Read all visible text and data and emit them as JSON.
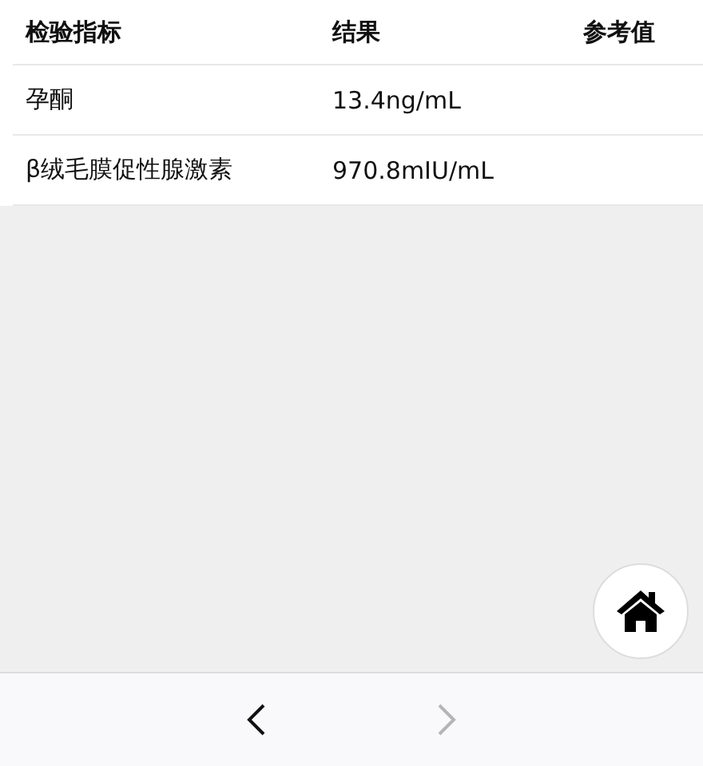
{
  "table": {
    "columns": [
      "检验指标",
      "结果",
      "参考值"
    ],
    "rows": [
      {
        "cells": [
          "孕酮",
          "13.4ng/mL"
        ]
      },
      {
        "cells": [
          "β绒毛膜促性腺激素",
          "970.8mIU/mL"
        ]
      }
    ]
  },
  "nav": [
    {
      "kind": "back",
      "disabled": false
    },
    {
      "kind": "forward",
      "disabled": true
    }
  ]
}
